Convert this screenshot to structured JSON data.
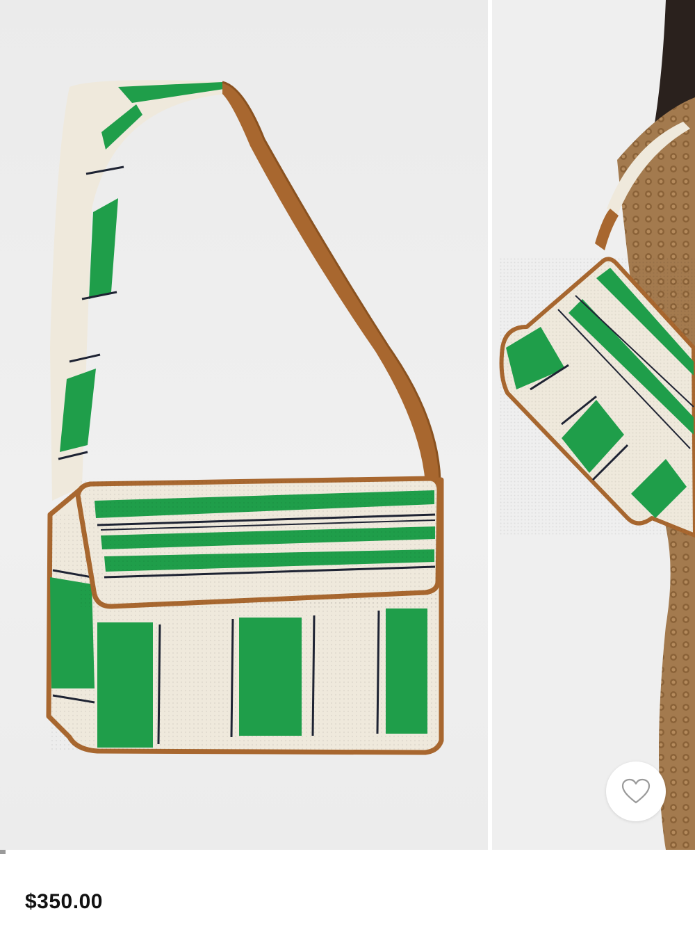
{
  "product": {
    "price": "$350.00",
    "images": [
      {
        "icon": "beaded-shoulder-bag-image"
      },
      {
        "icon": "model-wearing-bag-image"
      }
    ]
  },
  "wishlist": {
    "icon": "heart-outline-icon"
  },
  "colors": {
    "green": "#1f9e4a",
    "cream": "#efe9dc",
    "tan": "#a8672f",
    "navy": "#1e2333",
    "knit": "#a37a4e"
  }
}
